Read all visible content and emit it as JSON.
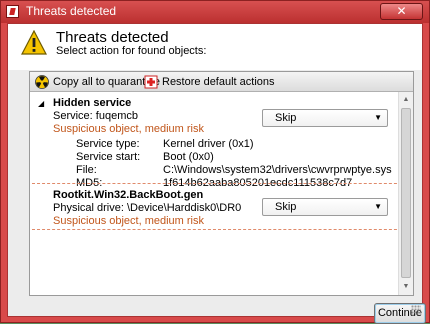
{
  "window": {
    "title": "Threats detected",
    "close_label": "✕"
  },
  "header": {
    "title": "Threats detected",
    "subtitle": "Select action for found objects:"
  },
  "toolbar": {
    "copy_label": "Copy all to quarantine",
    "restore_label": "Restore default actions"
  },
  "threats": [
    {
      "name": "Hidden service",
      "line": "Service: fuqemcb",
      "risk": "Suspicious object, medium risk",
      "action": "Skip",
      "details": [
        {
          "label": "Service type:",
          "value": "Kernel driver (0x1)"
        },
        {
          "label": "Service start:",
          "value": "Boot (0x0)"
        },
        {
          "label": "File:",
          "value": "C:\\Windows\\system32\\drivers\\cwvrprwptye.sys"
        },
        {
          "label": "MD5:",
          "value": "1f614b62aaba805201ecdc111538c7d7"
        }
      ]
    },
    {
      "name": "Rootkit.Win32.BackBoot.gen",
      "line": "Physical drive: \\Device\\Harddisk0\\DR0",
      "risk": "Suspicious object, medium risk",
      "action": "Skip"
    }
  ],
  "footer": {
    "continue_label": "Continue"
  },
  "icons": {
    "app": "kaspersky-k-icon",
    "warning": "warning-triangle-icon",
    "quarantine": "radiation-icon",
    "restore": "red-cross-icon"
  },
  "colors": {
    "risk_text": "#c1561b",
    "window_frame": "#d84a4a"
  }
}
